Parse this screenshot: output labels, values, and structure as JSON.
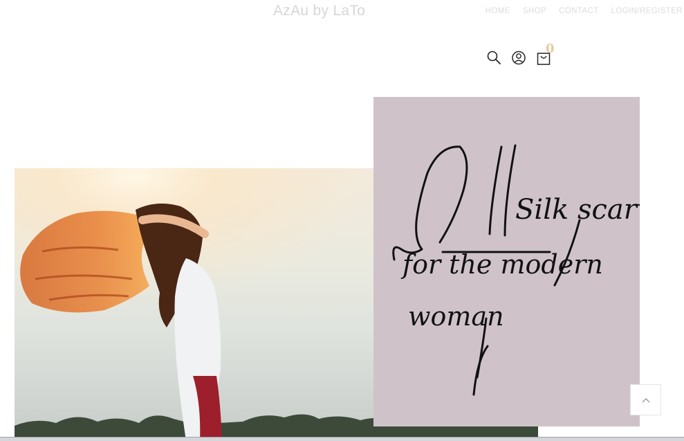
{
  "header": {
    "site_title": "AzAu by LaTo",
    "nav": {
      "home": "HOME",
      "shop": "SHOP",
      "contact": "CONTACT",
      "login": "LOGIN",
      "separator": "/",
      "register": "REGISTER"
    }
  },
  "icons": {
    "search": "search-icon",
    "account": "user-icon",
    "cart": "cart-icon",
    "cart_count": "0"
  },
  "hero": {
    "tagline_line1": "Silk scarves",
    "tagline_line2": "for the modern",
    "tagline_line3": "woman"
  },
  "colors": {
    "card_bg": "#cfc3c9",
    "cart_badge": "#e7c9a0",
    "nav_text": "#dcdcdc"
  }
}
